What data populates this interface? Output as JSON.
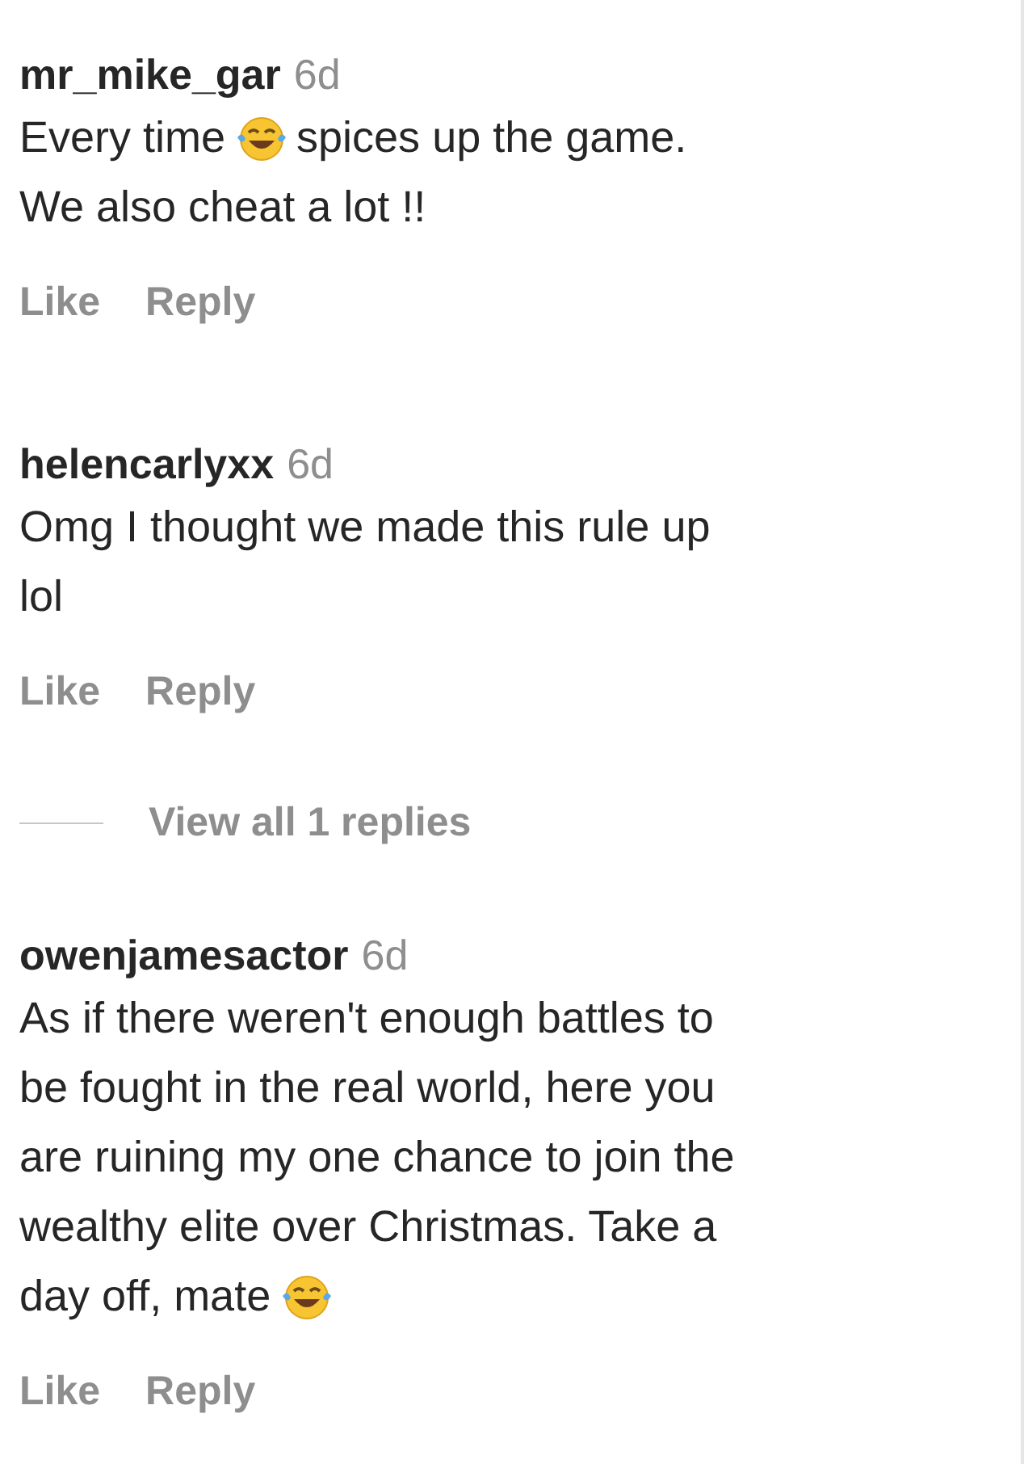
{
  "comments": [
    {
      "username": "mr_mike_gar",
      "time": "6d",
      "lines": [
        [
          {
            "kind": "text",
            "text": "Every time"
          },
          {
            "kind": "emoji"
          },
          {
            "kind": "text",
            "text": "spices up the game."
          }
        ],
        [
          {
            "kind": "text",
            "text": "We also cheat a lot !!"
          }
        ]
      ],
      "actions": [
        "Like",
        "Reply"
      ]
    },
    {
      "username": "helencarlyxx",
      "time": "6d",
      "lines": [
        [
          {
            "kind": "text",
            "text": "Omg I thought we made this rule up"
          }
        ],
        [
          {
            "kind": "text",
            "text": "lol"
          }
        ]
      ],
      "actions": [
        "Like",
        "Reply"
      ],
      "view_replies": "View all 1 replies"
    },
    {
      "username": "owenjamesactor",
      "time": "6d",
      "lines": [
        [
          {
            "kind": "text",
            "text": "As if there weren't enough battles to"
          }
        ],
        [
          {
            "kind": "text",
            "text": "be fought in the real world, here you"
          }
        ],
        [
          {
            "kind": "text",
            "text": "are ruining my one chance to join the"
          }
        ],
        [
          {
            "kind": "text",
            "text": "wealthy elite over Christmas. Take a"
          }
        ],
        [
          {
            "kind": "text",
            "text": "day off, mate"
          },
          {
            "kind": "emoji"
          }
        ]
      ],
      "actions": [
        "Like",
        "Reply"
      ]
    }
  ]
}
